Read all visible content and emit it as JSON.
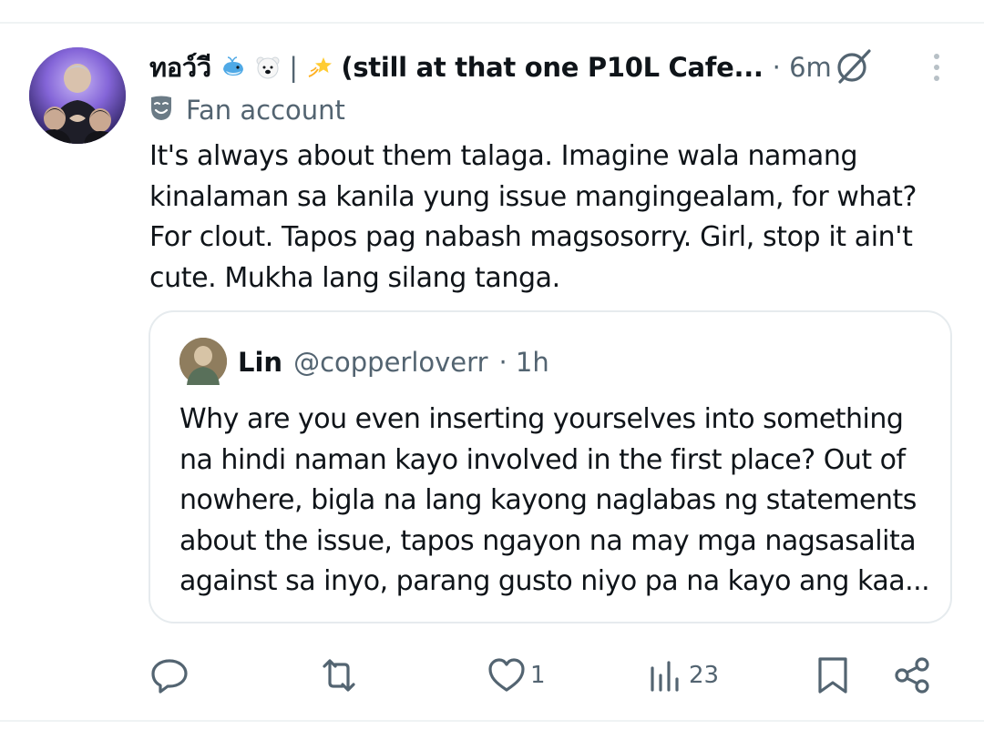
{
  "post": {
    "display_name": "ทอว์วี",
    "display_name_suffix": "(still at that one P10L Cafe...",
    "time": "· 6m",
    "label": "Fan account",
    "text": "It's always about them talaga. Imagine wala namang kinalaman sa kanila yung issue mangingealam, for what? For clout. Tapos pag nabash magsosorry. Girl, stop it ain't cute. Mukha lang silang tanga.",
    "icons": {
      "emojis": [
        "whale-icon",
        "polar-bear-icon",
        "dizzy-star-icon"
      ],
      "label_icon": "theater-mask-icon",
      "grok": "grok-icon",
      "more": "more-vertical-icon"
    }
  },
  "quote": {
    "name": "Lin",
    "handle": "@copperloverr",
    "time": "· 1h",
    "text": "Why are you even inserting yourselves into something na hindi naman kayo involved in the first place? Out of nowhere, bigla na lang kayong naglabas ng statements about the issue, tapos ngayon na may mga nagsasalita against sa inyo, parang gusto niyo pa na kayo ang kaa..."
  },
  "actions": {
    "reply": {
      "icon": "reply-icon",
      "count": ""
    },
    "repost": {
      "icon": "repost-icon",
      "count": ""
    },
    "like": {
      "icon": "heart-icon",
      "count": "1"
    },
    "views": {
      "icon": "views-icon",
      "count": "23"
    },
    "bookmark": {
      "icon": "bookmark-icon"
    },
    "share": {
      "icon": "share-icon"
    }
  },
  "colors": {
    "text_primary": "#0f1419",
    "text_secondary": "#536471",
    "border": "#e6ebee"
  }
}
